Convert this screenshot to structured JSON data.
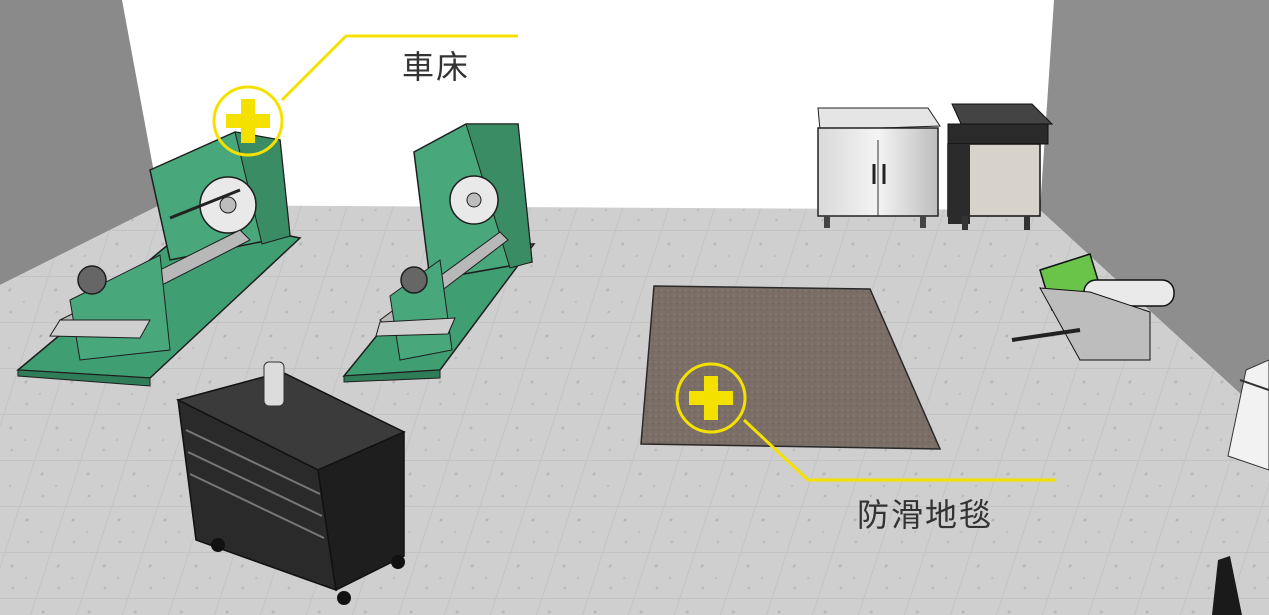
{
  "hotspots": {
    "lathe": {
      "label": "車床"
    },
    "mat": {
      "label": "防滑地毯"
    }
  },
  "colors": {
    "accent": "#f5e100",
    "machine_green": "#3f9f72",
    "floor": "#cdcdcd",
    "mat": "#7a6e66",
    "wall": "#8a8a8a"
  },
  "icons": {
    "hotspot": "plus-circle-icon"
  }
}
